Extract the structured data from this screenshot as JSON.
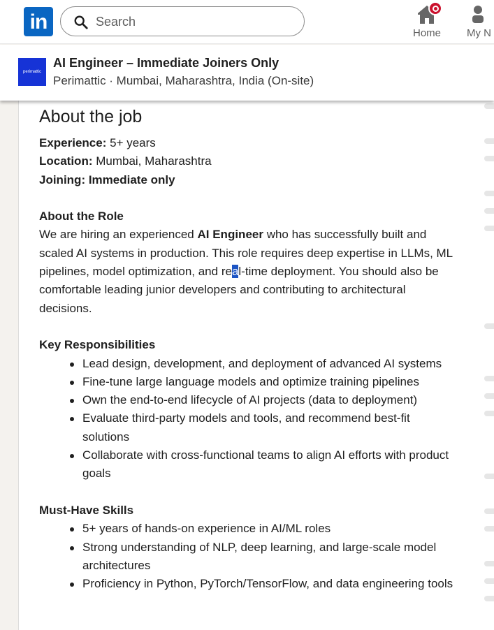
{
  "nav": {
    "logo_text": "in",
    "search_placeholder": "Search",
    "home_label": "Home",
    "network_label": "My N"
  },
  "job": {
    "company_logo_text": "perimattic",
    "title": "AI Engineer – Immediate Joiners Only",
    "subtitle": "Perimattic · Mumbai, Maharashtra, India (On-site)"
  },
  "about": {
    "heading": "About the job",
    "experience_label": "Experience:",
    "experience_value": " 5+ years",
    "location_label": "Location:",
    "location_value": " Mumbai, Maharashtra",
    "joining": "Joining: Immediate only"
  },
  "role": {
    "heading": "About the Role",
    "p1": "We are hiring an experienced ",
    "p1_bold": "AI Engineer",
    "p2": " who has successfully built and scaled AI systems in production. This role requires deep expertise in LLMs, ML pipelines, model optimization, and re",
    "p2_selected": "a",
    "p3": "l-time deployment. You should also be comfortable leading junior developers and contributing to architectural decisions."
  },
  "responsibilities": {
    "heading": "Key Responsibilities",
    "items": [
      "Lead design, development, and deployment of advanced AI systems",
      "Fine-tune large language models and optimize training pipelines",
      "Own the end-to-end lifecycle of AI projects (data to deployment)",
      "Evaluate third-party models and tools, and recommend best-fit solutions",
      "Collaborate with cross-functional teams to align AI efforts with product goals"
    ]
  },
  "skills": {
    "heading": "Must-Have Skills",
    "items": [
      "5+ years of hands-on experience in AI/ML roles",
      "Strong understanding of NLP, deep learning, and large-scale model architectures",
      "Proficiency in Python, PyTorch/TensorFlow, and data engineering tools"
    ]
  },
  "colors": {
    "brand": "#0a66c2",
    "notification": "#cb112d",
    "selection": "#1d55c4"
  }
}
